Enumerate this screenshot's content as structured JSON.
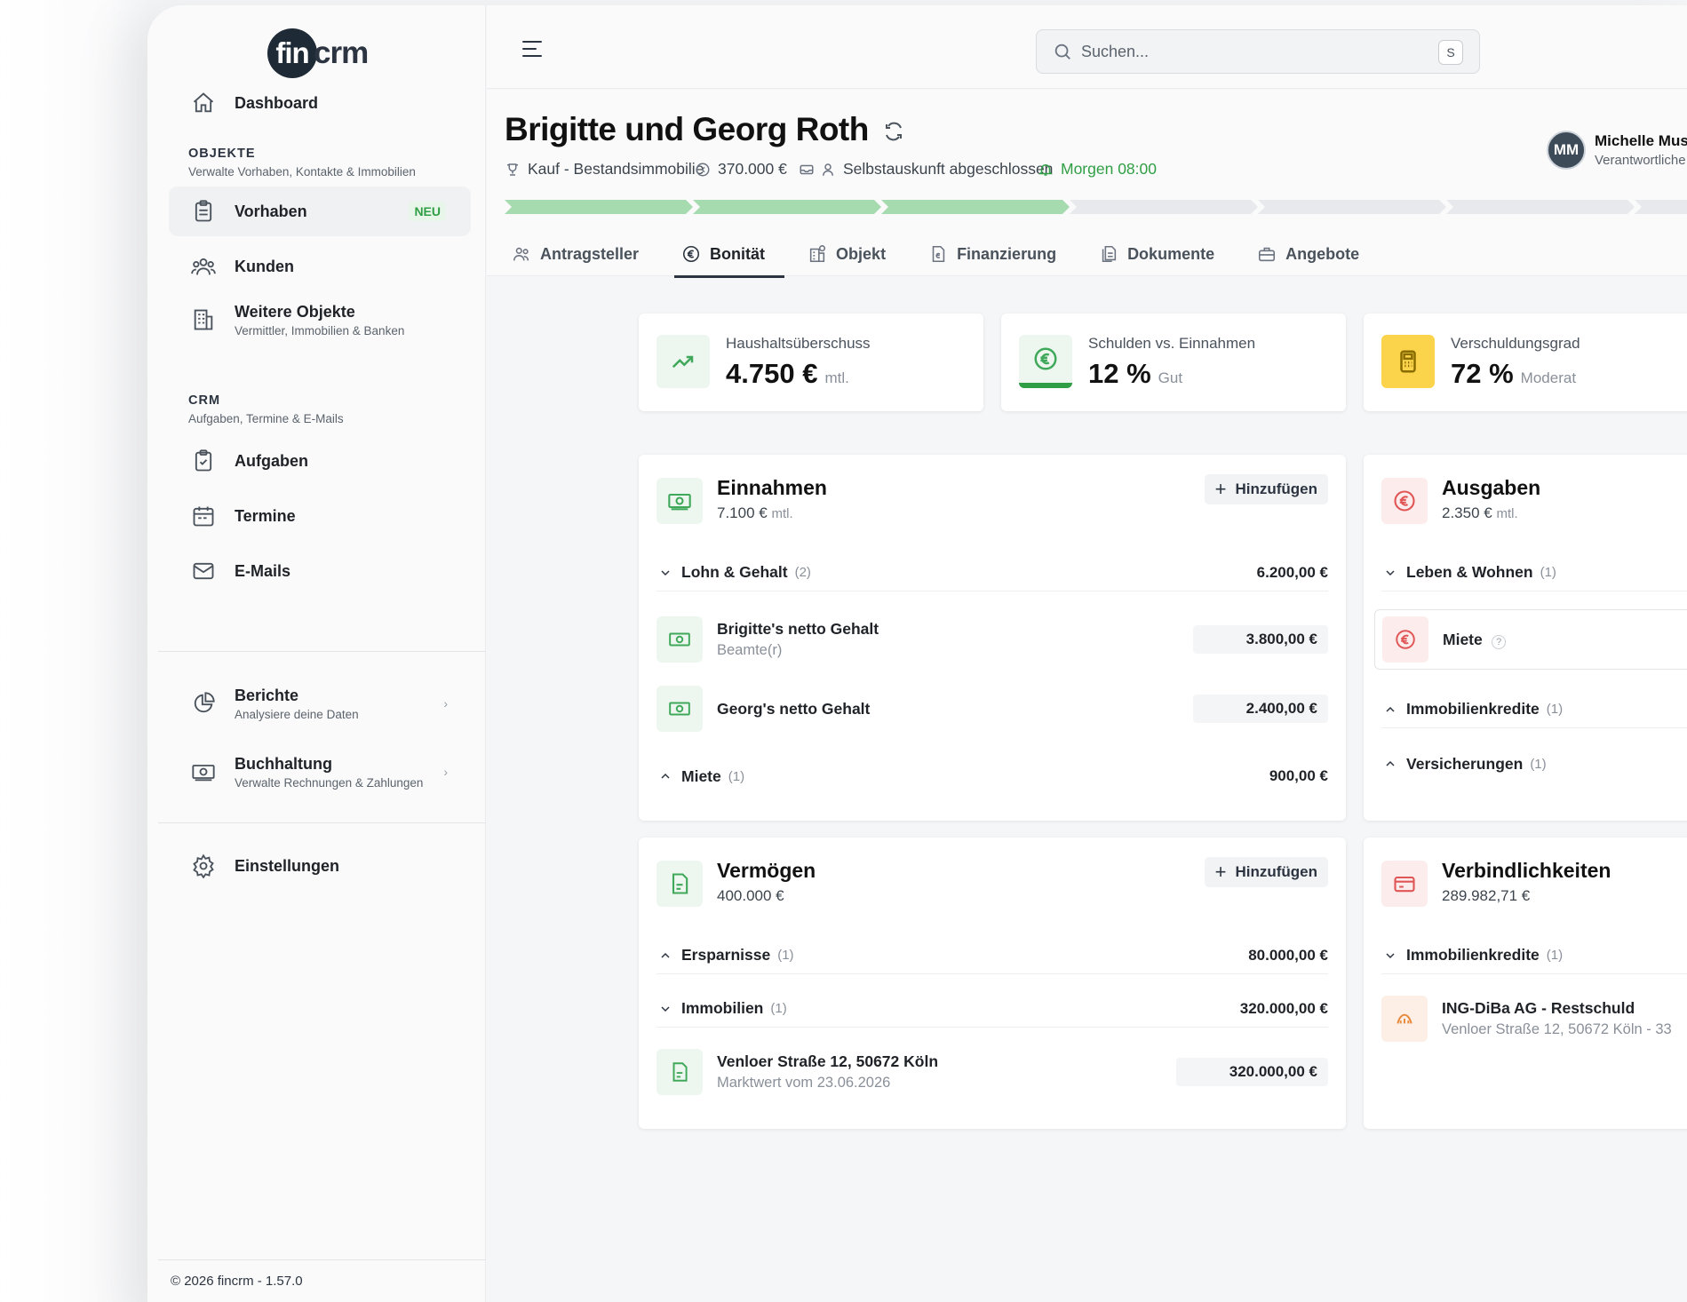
{
  "colors": {
    "accent_green": "#2f9e44",
    "progress_done": "#a6dbb0",
    "progress_todo": "#e8e9ec"
  },
  "sidebar": {
    "logo": {
      "mark": "fin",
      "text": "crm"
    },
    "dashboard": "Dashboard",
    "section_objekte": {
      "title": "OBJEKTE",
      "sub": "Verwalte Vorhaben, Kontakte & Immobilien"
    },
    "vorhaben": {
      "label": "Vorhaben",
      "badge": "NEU"
    },
    "kunden": "Kunden",
    "weitere": {
      "label": "Weitere Objekte",
      "sub": "Vermittler, Immobilien & Banken"
    },
    "section_crm": {
      "title": "CRM",
      "sub": "Aufgaben, Termine & E-Mails"
    },
    "aufgaben": "Aufgaben",
    "termine": "Termine",
    "emails": "E-Mails",
    "berichte": {
      "label": "Berichte",
      "sub": "Analysiere deine Daten"
    },
    "buchhaltung": {
      "label": "Buchhaltung",
      "sub": "Verwalte Rechnungen & Zahlungen"
    },
    "einstellungen": "Einstellungen",
    "footer": "© 2026 fincrm - 1.57.0"
  },
  "topbar": {
    "search_placeholder": "Suchen...",
    "shortcut": "S"
  },
  "header": {
    "title": "Brigitte und Georg Roth",
    "meta": {
      "type": "Kauf - Bestandsimmobilie",
      "amount": "370.000 €",
      "status": "Selbstauskunft abgeschlossen",
      "reminder": "Morgen 08:00"
    },
    "progress": {
      "completed_steps": 3,
      "total_steps": 7
    },
    "user": {
      "initials": "MM",
      "name": "Michelle Mus",
      "role": "Verantwortliche"
    },
    "tabs": [
      "Antragsteller",
      "Bonität",
      "Objekt",
      "Finanzierung",
      "Dokumente",
      "Angebote"
    ],
    "active_tab": "Bonität"
  },
  "kpis": [
    {
      "label": "Haushaltsüberschuss",
      "value": "4.750 €",
      "unit": "mtl.",
      "icon": "trend-up-icon"
    },
    {
      "label": "Schulden vs. Einnahmen",
      "value": "12 %",
      "unit": "Gut",
      "icon": "euro-icon"
    },
    {
      "label": "Verschuldungsgrad",
      "value": "72 %",
      "unit": "Moderat",
      "icon": "calculator-icon"
    }
  ],
  "einnahmen": {
    "title": "Einnahmen",
    "total": "7.100 €",
    "unit": "mtl.",
    "add_label": "Hinzufügen",
    "groups": {
      "lohn": {
        "label": "Lohn & Gehalt",
        "count": "(2)",
        "amount": "6.200,00 €"
      },
      "miete": {
        "label": "Miete",
        "count": "(1)",
        "amount": "900,00 €"
      }
    },
    "items": [
      {
        "name": "Brigitte's netto Gehalt",
        "sub": "Beamte(r)",
        "amount": "3.800,00 €"
      },
      {
        "name": "Georg's netto Gehalt",
        "sub": "",
        "amount": "2.400,00 €"
      }
    ]
  },
  "ausgaben": {
    "title": "Ausgaben",
    "total": "2.350 €",
    "unit": "mtl.",
    "groups": {
      "leben": {
        "label": "Leben & Wohnen",
        "count": "(1)"
      },
      "kredite": {
        "label": "Immobilienkredite",
        "count": "(1)"
      },
      "versicherungen": {
        "label": "Versicherungen",
        "count": "(1)"
      }
    },
    "items": [
      {
        "name": "Miete",
        "help": "?"
      }
    ]
  },
  "vermoegen": {
    "title": "Vermögen",
    "total": "400.000 €",
    "add_label": "Hinzufügen",
    "groups": {
      "ersparnisse": {
        "label": "Ersparnisse",
        "count": "(1)",
        "amount": "80.000,00 €"
      },
      "immobilien": {
        "label": "Immobilien",
        "count": "(1)",
        "amount": "320.000,00 €"
      }
    },
    "items": [
      {
        "name": "Venloer Straße 12, 50672 Köln",
        "sub": "Marktwert vom 23.06.2026",
        "amount": "320.000,00 €"
      }
    ]
  },
  "verbindlichkeiten": {
    "title": "Verbindlichkeiten",
    "total": "289.982,71 €",
    "groups": {
      "kredite": {
        "label": "Immobilienkredite",
        "count": "(1)"
      }
    },
    "items": [
      {
        "name": "ING-DiBa AG - Restschuld",
        "sub": "Venloer Straße 12, 50672 Köln - 33"
      }
    ]
  }
}
